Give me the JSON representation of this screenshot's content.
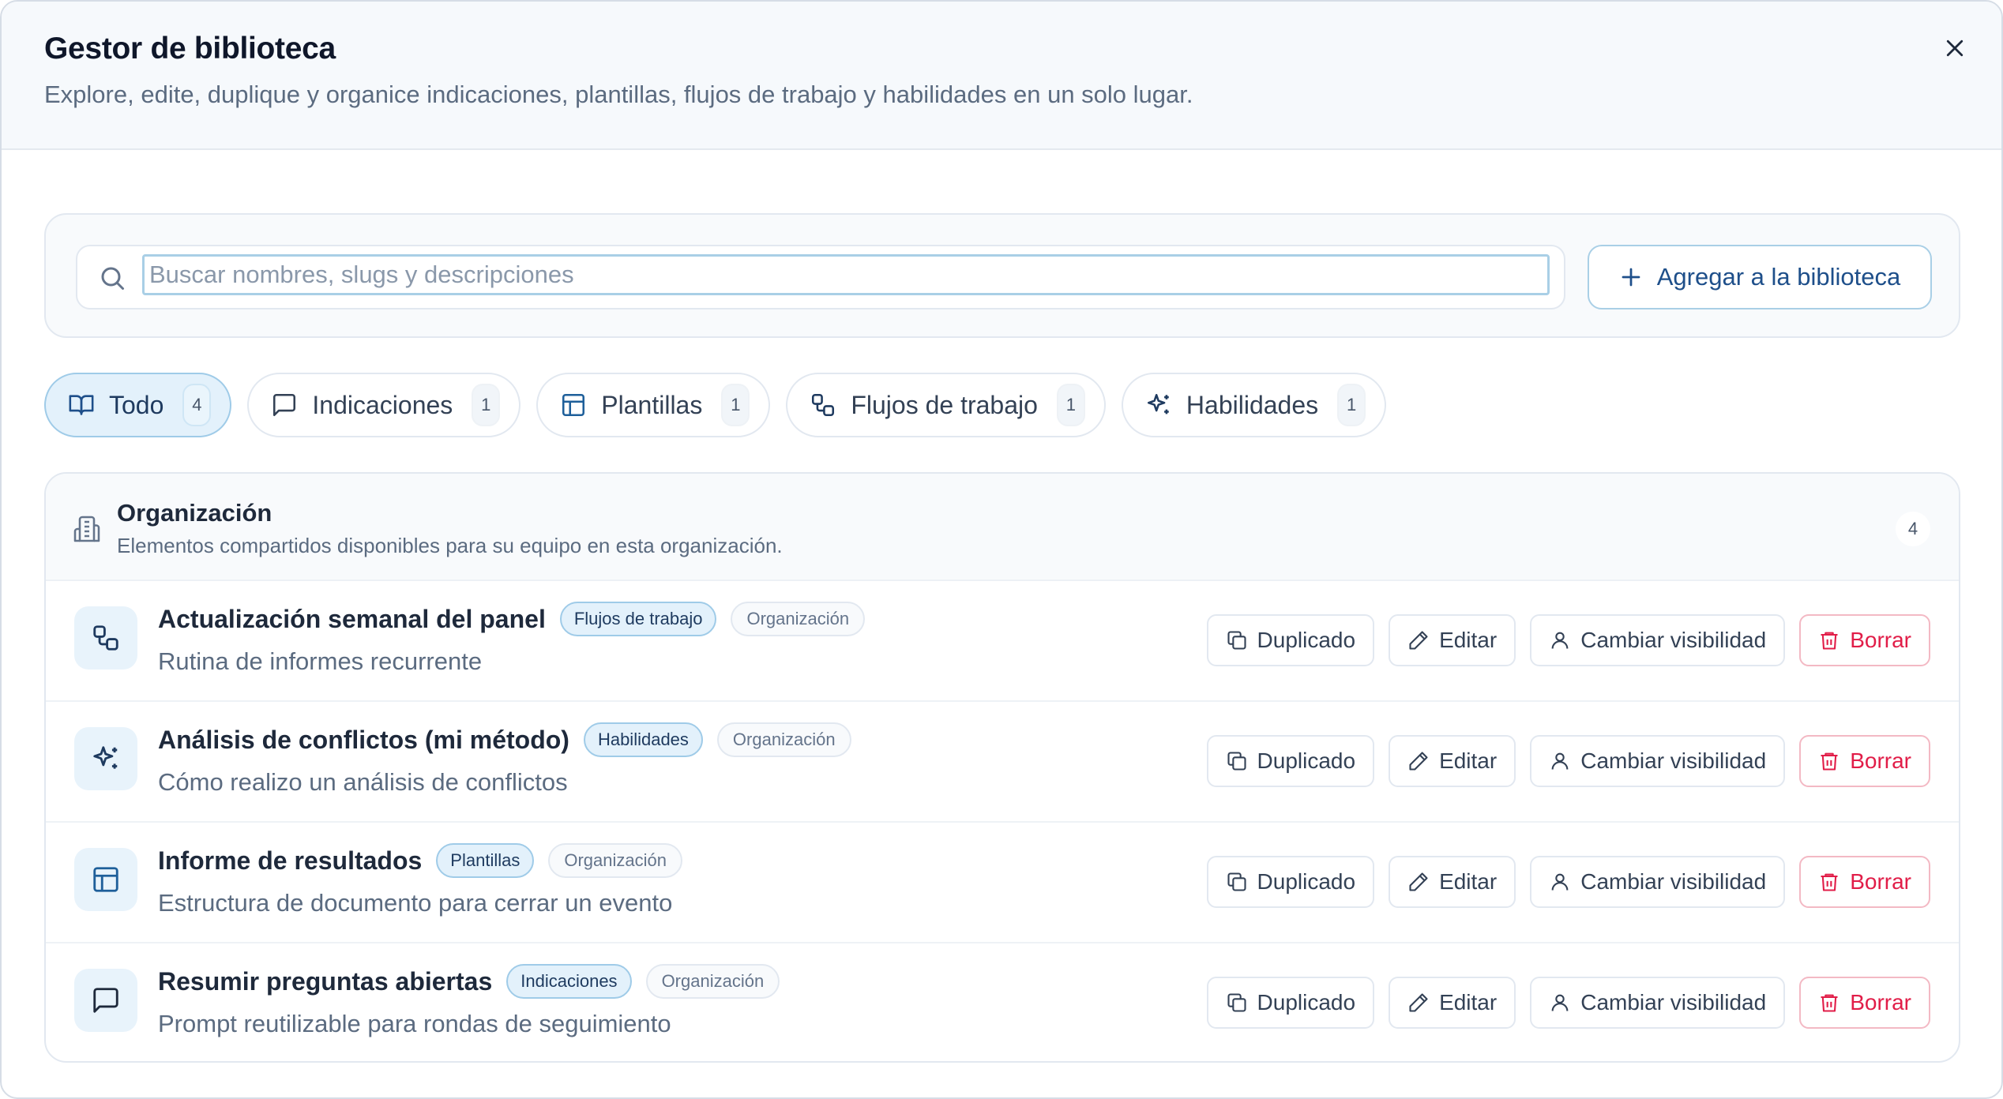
{
  "dialog": {
    "title": "Gestor de biblioteca",
    "subtitle": "Explore, edite, duplique y organice indicaciones, plantillas, flujos de trabajo y habilidades en un solo lugar.",
    "close_icon": "close-icon"
  },
  "search": {
    "placeholder": "Buscar nombres, slugs y descripciones",
    "value": "",
    "add_label": "Agregar a la biblioteca"
  },
  "tabs": [
    {
      "label": "Todo",
      "count": "4",
      "icon": "book-open-icon",
      "active": true
    },
    {
      "label": "Indicaciones",
      "count": "1",
      "icon": "message-square-icon",
      "active": false
    },
    {
      "label": "Plantillas",
      "count": "1",
      "icon": "layout-template-icon",
      "active": false
    },
    {
      "label": "Flujos de trabajo",
      "count": "1",
      "icon": "workflow-icon",
      "active": false
    },
    {
      "label": "Habilidades",
      "count": "1",
      "icon": "sparkles-icon",
      "active": false
    }
  ],
  "section": {
    "title": "Organización",
    "description": "Elementos compartidos disponibles para su equipo en esta organización.",
    "count": "4"
  },
  "actions": {
    "duplicate": "Duplicado",
    "edit": "Editar",
    "visibility": "Cambiar visibilidad",
    "delete": "Borrar"
  },
  "items": [
    {
      "title": "Actualización semanal del panel",
      "type": "Flujos de trabajo",
      "scope": "Organización",
      "description": "Rutina de informes recurrente",
      "icon": "workflow-icon"
    },
    {
      "title": "Análisis de conflictos (mi método)",
      "type": "Habilidades",
      "scope": "Organización",
      "description": "Cómo realizo un análisis de conflictos",
      "icon": "sparkles-icon"
    },
    {
      "title": "Informe de resultados",
      "type": "Plantillas",
      "scope": "Organización",
      "description": "Estructura de documento para cerrar un evento",
      "icon": "layout-template-icon"
    },
    {
      "title": "Resumir preguntas abiertas",
      "type": "Indicaciones",
      "scope": "Organización",
      "description": "Prompt reutilizable para rondas de seguimiento",
      "icon": "message-square-icon"
    }
  ],
  "colors": {
    "accent": "#1e4f8a",
    "accent_border": "#9fcbe8",
    "danger": "#e11d48"
  }
}
